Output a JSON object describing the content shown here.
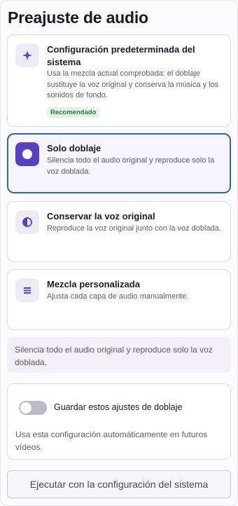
{
  "title": "Preajuste de audio",
  "options": [
    {
      "title": "Configuración predeterminada del sistema",
      "description": "Usa la mezcla actual comprobada: el doblaje sustituye la voz original y conserva la música y los sonidos de fondo.",
      "badge": "Recomendado",
      "icon": "sparkle-icon",
      "selected": false
    },
    {
      "title": "Solo doblaje",
      "description": "Silencia todo el audio original y reproduce solo la voz doblada.",
      "icon": "circle-icon",
      "selected": true
    },
    {
      "title": "Conservar la voz original",
      "description": "Reproduce la voz original junto con la voz doblada.",
      "icon": "half-circle-icon",
      "selected": false
    },
    {
      "title": "Mezcla personalizada",
      "description": "Ajusta cada capa de audio manualmente.",
      "icon": "menu-lines-icon",
      "selected": false
    }
  ],
  "info_text": "Silencia todo el audio original y reproduce solo la voz doblada.",
  "save": {
    "toggle_label": "Guardar estos ajustes de doblaje",
    "toggle_on": false,
    "description": "Usa esta configuración automáticamente en futuros vídeos."
  },
  "run_button": "Ejecutar con la configuración del sistema",
  "colors": {
    "accent": "#5a3fbf",
    "selected_border": "#2f64b0",
    "badge_text": "#2f7a3e",
    "badge_bg": "#e3f3e6"
  }
}
